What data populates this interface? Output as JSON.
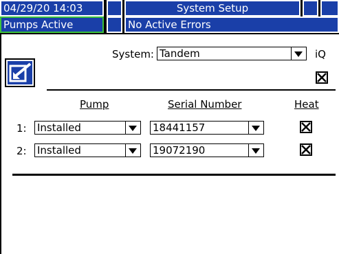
{
  "status_bar": {
    "datetime": "04/29/20 14:03",
    "screen_title": "System Setup",
    "pumps_status": "Pumps Active",
    "errors_status": "No Active Errors"
  },
  "system": {
    "label": "System:",
    "value": "Tandem",
    "iq_label": "iQ",
    "iq_checked": true
  },
  "table": {
    "headers": {
      "pump": "Pump",
      "serial": "Serial Number",
      "heat": "Heat"
    },
    "rows": [
      {
        "index": "1:",
        "pump": "Installed",
        "serial": "18441157",
        "heat": true
      },
      {
        "index": "2:",
        "pump": "Installed",
        "serial": "19072190",
        "heat": true
      }
    ]
  },
  "icons": {
    "edit": "edit-arrow-icon"
  },
  "colors": {
    "status_bg": "#1a3fa8",
    "active_border": "#3cc43c"
  }
}
